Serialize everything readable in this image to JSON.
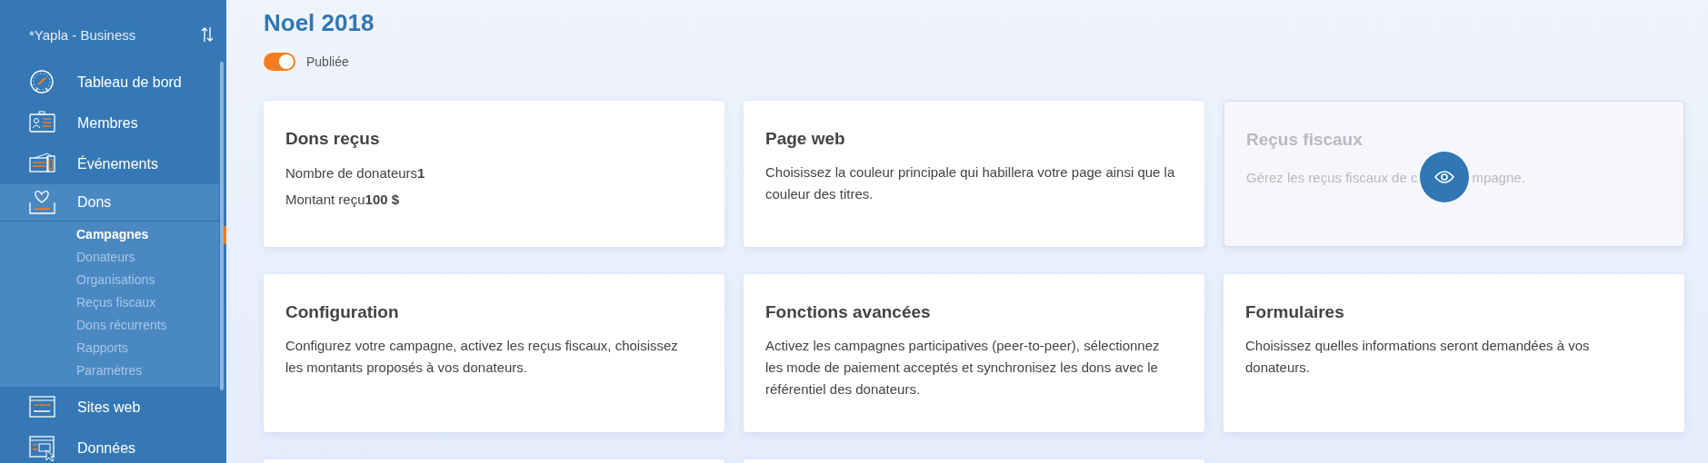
{
  "sidebar": {
    "account": "*Yapla - Business",
    "items": [
      {
        "label": "Tableau de bord",
        "selected": false
      },
      {
        "label": "Membres",
        "selected": false
      },
      {
        "label": "Événements",
        "selected": false
      },
      {
        "label": "Dons",
        "selected": true,
        "expanded": true,
        "children": [
          {
            "label": "Campagnes",
            "selected": true
          },
          {
            "label": "Donateurs",
            "selected": false
          },
          {
            "label": "Organisations",
            "selected": false
          },
          {
            "label": "Reçus fiscaux",
            "selected": false
          },
          {
            "label": "Dons récurrents",
            "selected": false
          },
          {
            "label": "Rapports",
            "selected": false
          },
          {
            "label": "Paramètres",
            "selected": false
          }
        ]
      },
      {
        "label": "Sites web",
        "selected": false
      },
      {
        "label": "Données",
        "selected": false
      }
    ]
  },
  "page": {
    "title": "Noel 2018",
    "published": {
      "label": "Publiée",
      "on": true
    }
  },
  "cards": [
    {
      "kind": "stats",
      "title": "Dons reçus",
      "disabled": false,
      "lines": [
        "Nombre de donateurs**1**",
        "Montant reçu**100 $**"
      ]
    },
    {
      "kind": "text",
      "title": "Page web",
      "disabled": false,
      "description": "Choisissez la couleur principale qui habillera votre page ainsi que la couleur des titres."
    },
    {
      "kind": "preview",
      "title": "Reçus fiscaux",
      "disabled": true,
      "description_before": "Gérez les reçus fiscaux de c",
      "description_after": "mpagne."
    },
    {
      "kind": "text",
      "title": "Configuration",
      "disabled": false,
      "description": "Configurez votre campagne, activez les reçus fiscaux, choisissez les montants proposés à vos donateurs."
    },
    {
      "kind": "text",
      "title": "Fonctions avancées",
      "disabled": false,
      "description": "Activez les campagnes participatives (peer-to-peer), sélectionnez les mode de paiement acceptés et synchronisez les dons avec le référentiel des donateurs."
    },
    {
      "kind": "text",
      "title": "Formulaires",
      "disabled": false,
      "description": "Choisissez quelles informations seront demandées à vos donateurs."
    },
    {
      "kind": "cut-off",
      "disabled": false
    },
    {
      "kind": "cut-off",
      "disabled": false
    }
  ]
}
